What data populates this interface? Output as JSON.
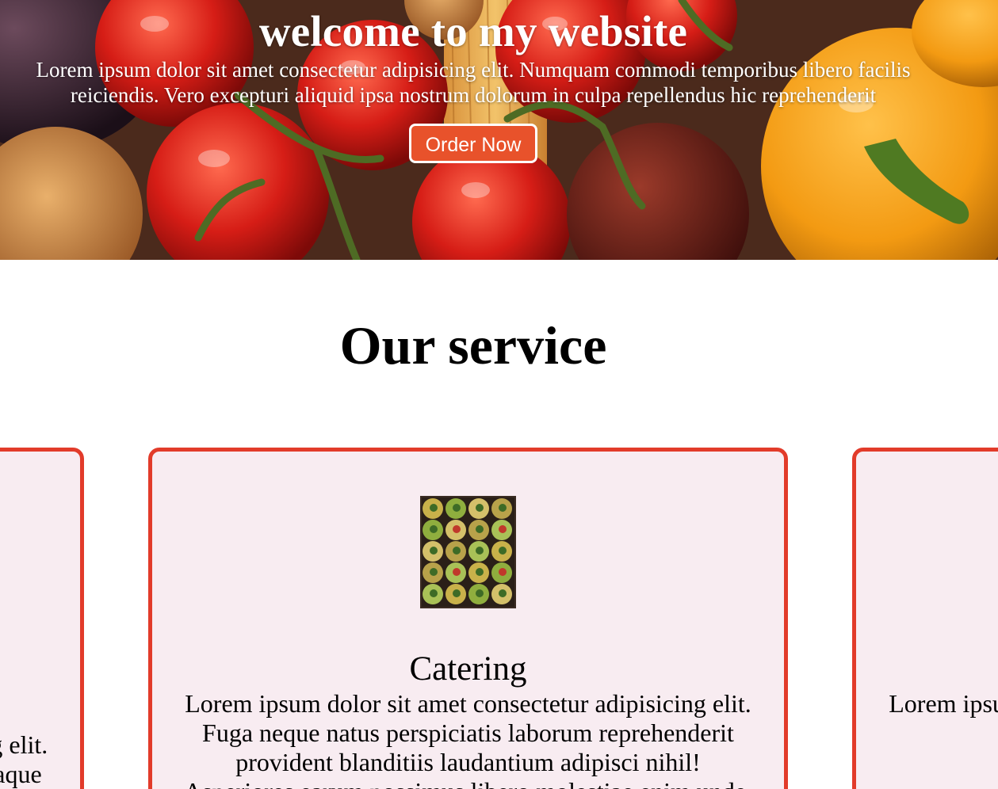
{
  "hero": {
    "title": "welcome to my website",
    "text": "Lorem ipsum dolor sit amet consectetur adipisicing elit. Numquam commodi temporibus libero facilis reiciendis. Vero excepturi aliquid ipsa nostrum dolorum in culpa repellendus hic reprehenderit",
    "button_label": "Order Now",
    "button_color": "#e8522b"
  },
  "service": {
    "title": "Our service",
    "cards": [
      {
        "title": "",
        "text": "Lorem ipsum dolor sit amet consectetur adipisicing elit. Aliquid ratione quo accusamus laboriosam, rem itaque vero iusto fugiat laborum"
      },
      {
        "title": "Catering",
        "text": "Lorem ipsum dolor sit amet consectetur adipisicing elit. Fuga neque natus perspiciatis laborum reprehenderit provident blanditiis laudantium adipisci nihil! Asperiores earum possimus libero molestiae enim unde."
      },
      {
        "title": "",
        "text": "Lorem ipsum dolor sit amet consectetur adipisicing elit. Alias harum expedita quas"
      }
    ],
    "border_color": "#e23b2a",
    "card_background": "#f8ecf1"
  }
}
